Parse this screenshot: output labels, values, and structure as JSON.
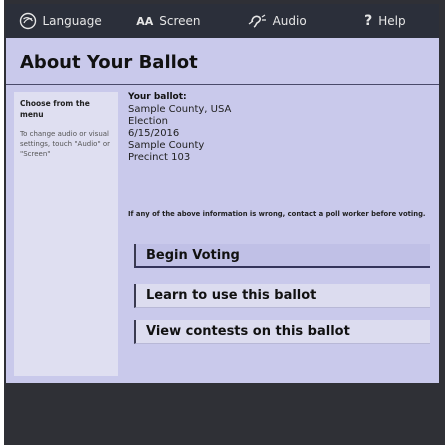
{
  "topbar": {
    "items": [
      {
        "label": "Language",
        "icon": "language-icon"
      },
      {
        "label": "Screen",
        "icon_text": "AA",
        "icon": "screen-icon"
      },
      {
        "label": "Audio",
        "icon": "audio-icon"
      },
      {
        "label": "Help",
        "icon_text": "?",
        "icon": "help-icon"
      }
    ]
  },
  "page": {
    "title": "About Your Ballot"
  },
  "sidebar": {
    "heading": "Choose from the menu",
    "hint": "To change audio or visual settings, touch \"Audio\" or \"Screen\""
  },
  "ballot": {
    "label": "Your ballot:",
    "lines": [
      "Sample County, USA",
      "Election",
      "6/15/2016",
      "Sample County",
      "Precinct 103"
    ]
  },
  "notice": "If any of the above information is wrong, contact a poll worker before voting.",
  "actions": {
    "begin": "Begin Voting",
    "learn": "Learn to use this ballot",
    "view": "View contests on this ballot"
  },
  "colors": {
    "panel": "#c9c9eb",
    "sidebar": "#dfdff1",
    "topbar": "#2b2f3a",
    "frame": "#2f3036"
  }
}
